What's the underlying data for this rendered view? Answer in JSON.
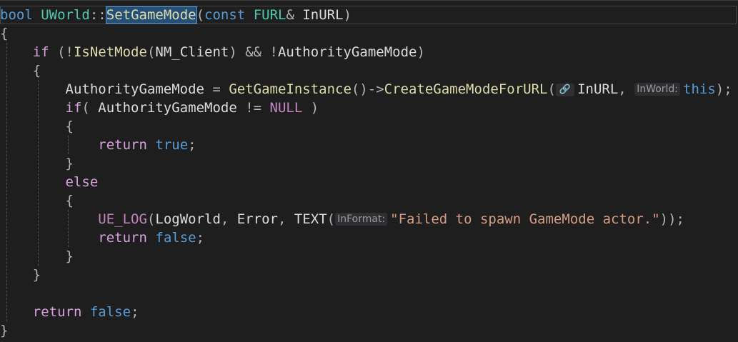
{
  "editor": {
    "lines": [
      {
        "id": "l1",
        "tokens": [
          [
            "kw",
            "bool"
          ],
          [
            "sp",
            " "
          ],
          [
            "type2",
            "UWorld"
          ],
          [
            "punct",
            "::"
          ],
          [
            "sel",
            "SetGameMode"
          ],
          [
            "punct",
            "("
          ],
          [
            "kw",
            "const"
          ],
          [
            "sp",
            " "
          ],
          [
            "type",
            "FURL"
          ],
          [
            "punct",
            "& "
          ],
          [
            "var",
            "InURL"
          ],
          [
            "punct",
            ")"
          ]
        ]
      },
      {
        "id": "l2",
        "tokens": [
          [
            "punct",
            "{"
          ]
        ]
      },
      {
        "id": "l3",
        "tokens": [
          [
            "sp",
            "    "
          ],
          [
            "ctrl",
            "if"
          ],
          [
            "punct",
            " (!"
          ],
          [
            "fn",
            "IsNetMode"
          ],
          [
            "punct",
            "("
          ],
          [
            "var",
            "NM_Client"
          ],
          [
            "punct",
            ") && !"
          ],
          [
            "authority",
            "AuthorityGameMode"
          ],
          [
            "punct",
            ")"
          ]
        ]
      },
      {
        "id": "l4",
        "tokens": [
          [
            "sp",
            "    "
          ],
          [
            "punct",
            "{"
          ]
        ]
      },
      {
        "id": "l5",
        "tokens": [
          [
            "sp",
            "        "
          ],
          [
            "authority",
            "AuthorityGameMode"
          ],
          [
            "punct",
            " = "
          ],
          [
            "fn",
            "GetGameInstance"
          ],
          [
            "punct",
            "()->"
          ],
          [
            "fn",
            "CreateGameModeForURL"
          ],
          [
            "punct",
            "("
          ],
          [
            "hinticon",
            "🔗"
          ],
          [
            "var",
            "InURL"
          ],
          [
            "punct",
            ", "
          ],
          [
            "hint",
            "InWorld:"
          ],
          [
            "kw",
            "this"
          ],
          [
            "punct",
            ");"
          ]
        ]
      },
      {
        "id": "l6",
        "tokens": [
          [
            "sp",
            "        "
          ],
          [
            "ctrl",
            "if"
          ],
          [
            "punct",
            "( "
          ],
          [
            "authority",
            "AuthorityGameMode"
          ],
          [
            "punct",
            " != "
          ],
          [
            "null",
            "NULL"
          ],
          [
            "punct",
            " )"
          ]
        ]
      },
      {
        "id": "l7",
        "tokens": [
          [
            "sp",
            "        "
          ],
          [
            "punct",
            "{"
          ]
        ]
      },
      {
        "id": "l8",
        "tokens": [
          [
            "sp",
            "            "
          ],
          [
            "ctrl",
            "return"
          ],
          [
            "punct",
            " "
          ],
          [
            "kw",
            "true"
          ],
          [
            "punct",
            ";"
          ]
        ]
      },
      {
        "id": "l9",
        "tokens": [
          [
            "sp",
            "        "
          ],
          [
            "punct",
            "}"
          ]
        ]
      },
      {
        "id": "l10",
        "tokens": [
          [
            "sp",
            "        "
          ],
          [
            "ctrl",
            "else"
          ]
        ]
      },
      {
        "id": "l11",
        "tokens": [
          [
            "sp",
            "        "
          ],
          [
            "punct",
            "{"
          ]
        ]
      },
      {
        "id": "l12",
        "tokens": [
          [
            "sp",
            "            "
          ],
          [
            "purple",
            "UE_LOG"
          ],
          [
            "punct",
            "("
          ],
          [
            "var",
            "LogWorld"
          ],
          [
            "punct",
            ", "
          ],
          [
            "var",
            "Error"
          ],
          [
            "punct",
            ", "
          ],
          [
            "var",
            "TEXT"
          ],
          [
            "punct",
            "("
          ],
          [
            "hint",
            "InFormat:"
          ],
          [
            "str",
            "\"Failed to spawn GameMode actor.\""
          ],
          [
            "punct",
            "));"
          ]
        ]
      },
      {
        "id": "l13",
        "tokens": [
          [
            "sp",
            "            "
          ],
          [
            "ctrl",
            "return"
          ],
          [
            "punct",
            " "
          ],
          [
            "kw",
            "false"
          ],
          [
            "punct",
            ";"
          ]
        ]
      },
      {
        "id": "l14",
        "tokens": [
          [
            "sp",
            "        "
          ],
          [
            "punct",
            "}"
          ]
        ]
      },
      {
        "id": "l15",
        "tokens": [
          [
            "sp",
            "    "
          ],
          [
            "punct",
            "}"
          ]
        ]
      },
      {
        "id": "l16",
        "tokens": []
      },
      {
        "id": "l17",
        "tokens": [
          [
            "sp",
            "    "
          ],
          [
            "ctrl",
            "return"
          ],
          [
            "punct",
            " "
          ],
          [
            "kw",
            "false"
          ],
          [
            "punct",
            ";"
          ]
        ]
      },
      {
        "id": "l18",
        "tokens": [
          [
            "punct",
            "}"
          ]
        ]
      }
    ]
  },
  "colors": {
    "background": "#1e1e1e",
    "keyword": "#569cd6",
    "control": "#d8a0df",
    "type": "#4ec9b0",
    "function": "#dcdcaa",
    "string": "#d69d85",
    "macro": "#c586c0",
    "selection": "#264f78"
  }
}
